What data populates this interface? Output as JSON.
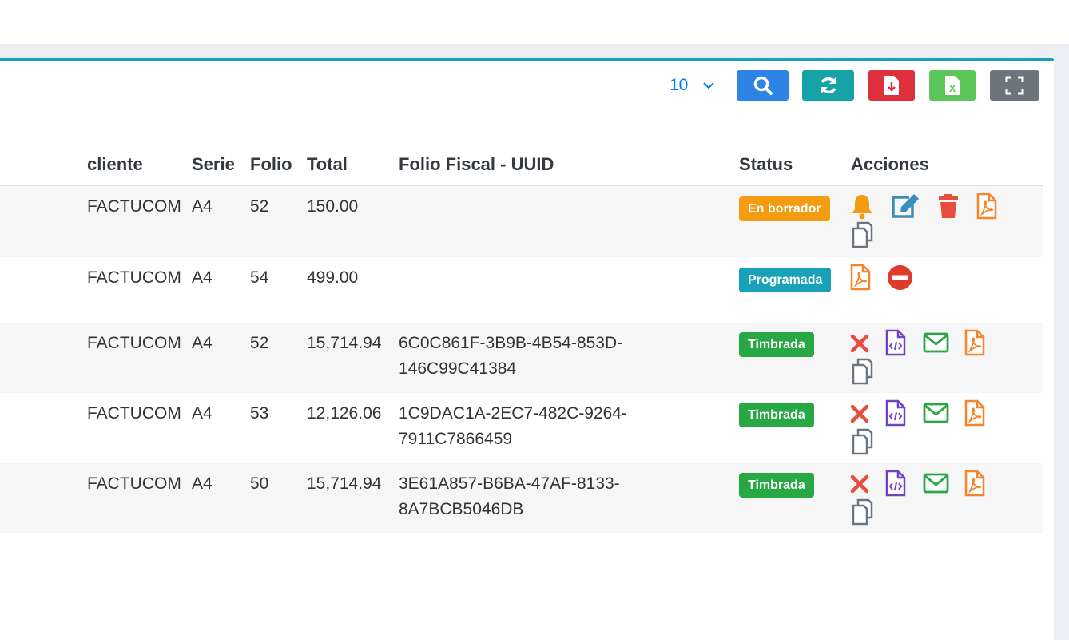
{
  "toolbar": {
    "per_page_value": "10",
    "buttons": [
      {
        "name": "search",
        "icon": "search-icon",
        "color": "#2d83e6"
      },
      {
        "name": "refresh",
        "icon": "refresh-icon",
        "color": "#16a2a6"
      },
      {
        "name": "export-pdf",
        "icon": "pdf-download-icon",
        "color": "#e0303d"
      },
      {
        "name": "export-excel",
        "icon": "excel-icon",
        "color": "#5cc65a"
      },
      {
        "name": "fullscreen",
        "icon": "fullscreen-icon",
        "color": "#6c757d"
      }
    ]
  },
  "table": {
    "columns": [
      "cliente",
      "Serie",
      "Folio",
      "Total",
      "Folio Fiscal - UUID",
      "Status",
      "Acciones"
    ],
    "rows": [
      {
        "cliente": "FACTUCOM",
        "serie": "A4",
        "folio": "52",
        "total": "150.00",
        "uuid_line1": "",
        "uuid_line2": "",
        "status": "En borrador",
        "status_color": "#f39c12",
        "actions": [
          "bell-icon",
          "edit-icon",
          "trash-icon",
          "pdf-file-icon",
          "copy-icon"
        ]
      },
      {
        "cliente": "FACTUCOM",
        "serie": "A4",
        "folio": "54",
        "total": "499.00",
        "uuid_line1": "",
        "uuid_line2": "",
        "status": "Programada",
        "status_color": "#17a2b8",
        "actions": [
          "pdf-file-icon",
          "minus-circle-icon"
        ]
      },
      {
        "cliente": "FACTUCOM",
        "serie": "A4",
        "folio": "52",
        "total": "15,714.94",
        "uuid_line1": "6C0C861F-3B9B-4B54-853D-",
        "uuid_line2": "146C99C41384",
        "status": "Timbrada",
        "status_color": "#28a745",
        "actions": [
          "cancel-x-icon",
          "xml-file-icon",
          "envelope-icon",
          "pdf-file-icon",
          "copy-icon"
        ]
      },
      {
        "cliente": "FACTUCOM",
        "serie": "A4",
        "folio": "53",
        "total": "12,126.06",
        "uuid_line1": "1C9DAC1A-2EC7-482C-9264-",
        "uuid_line2": "7911C7866459",
        "status": "Timbrada",
        "status_color": "#28a745",
        "actions": [
          "cancel-x-icon",
          "xml-file-icon",
          "envelope-icon",
          "pdf-file-icon",
          "copy-icon"
        ]
      },
      {
        "cliente": "FACTUCOM",
        "serie": "A4",
        "folio": "50",
        "total": "15,714.94",
        "uuid_line1": "3E61A857-B6BA-47AF-8133-",
        "uuid_line2": "8A7BCB5046DB",
        "status": "Timbrada",
        "status_color": "#28a745",
        "actions": [
          "cancel-x-icon",
          "xml-file-icon",
          "envelope-icon",
          "pdf-file-icon",
          "copy-icon"
        ]
      }
    ]
  },
  "colors": {
    "accent": "#17a2b8",
    "link": "#007bff",
    "danger": "#e74c3c",
    "xml": "#6f42c1",
    "mail": "#28a745",
    "pdf": "#f7842d",
    "copy": "#6c757d"
  }
}
